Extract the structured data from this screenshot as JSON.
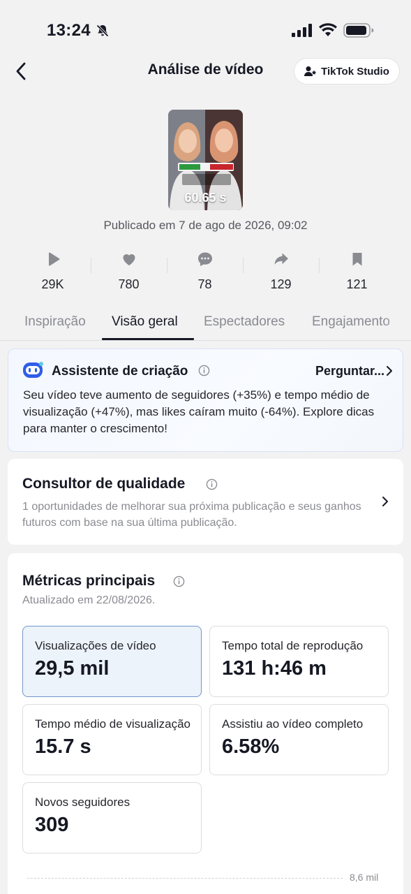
{
  "status_bar": {
    "time": "13:24",
    "icons": [
      "bell-slash-icon",
      "signal-icon",
      "wifi-icon",
      "battery-icon"
    ]
  },
  "header": {
    "title": "Análise de vídeo",
    "back_icon": "chevron-left-icon",
    "studio_button": "TikTok Studio",
    "studio_icon": "user-star-icon"
  },
  "video": {
    "duration": "60.65 s",
    "published": "Publicado em 7 de ago de 2026, 09:02"
  },
  "stats": [
    {
      "icon": "play-icon",
      "value": "29K"
    },
    {
      "icon": "heart-icon",
      "value": "780"
    },
    {
      "icon": "comment-icon",
      "value": "78"
    },
    {
      "icon": "share-icon",
      "value": "129"
    },
    {
      "icon": "bookmark-icon",
      "value": "121"
    }
  ],
  "tabs": [
    {
      "label": "Inspiração",
      "active": false
    },
    {
      "label": "Visão geral",
      "active": true
    },
    {
      "label": "Espectadores",
      "active": false
    },
    {
      "label": "Engajamento",
      "active": false
    }
  ],
  "assistant": {
    "title": "Assistente de criação",
    "ask_label": "Perguntar...",
    "body": "Seu vídeo teve aumento de seguidores (+35%) e tempo médio de visualização (+47%), mas likes caíram muito (-64%). Explore dicas para manter o crescimento!"
  },
  "quality": {
    "title": "Consultor de qualidade",
    "body": "1 oportunidades de melhorar sua próxima publicação e seus ganhos futuros com base na sua última publicação."
  },
  "metrics": {
    "title": "Métricas principais",
    "updated": "Atualizado em 22/08/2026.",
    "items": [
      {
        "label": "Visualizações de vídeo",
        "value": "29,5 mil",
        "selected": true
      },
      {
        "label": "Tempo total de reprodução",
        "value": "131 h:46 m",
        "selected": false
      },
      {
        "label": "Tempo médio de visualização",
        "value": "15.7 s",
        "selected": false
      },
      {
        "label": "Assistiu ao vídeo completo",
        "value": "6.58%",
        "selected": false
      },
      {
        "label": "Novos seguidores",
        "value": "309",
        "selected": false
      }
    ],
    "chart_tick": "8,6 mil"
  },
  "colors": {
    "accent_border": "#6f95c7",
    "selected_bg": "#edf3fb",
    "text_primary": "#161823",
    "text_secondary": "#8a8b91"
  }
}
